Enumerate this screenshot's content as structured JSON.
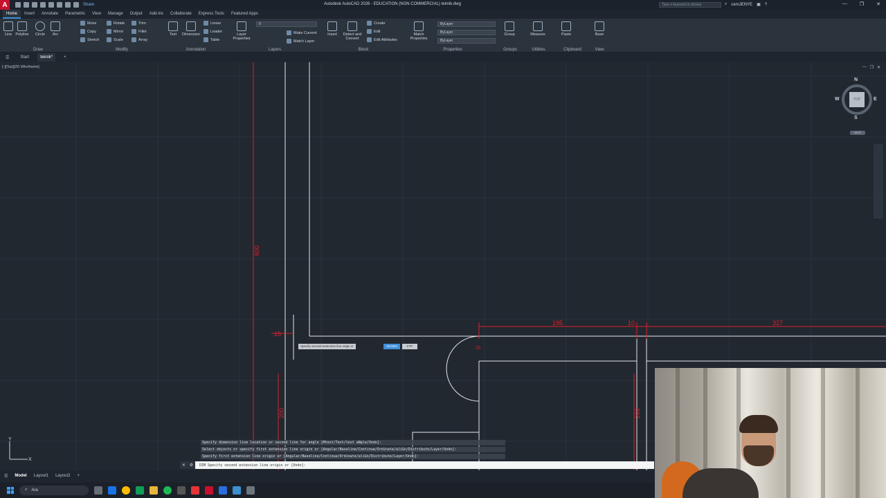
{
  "titlebar": {
    "logo": "A",
    "share": "Share",
    "title": "Autodesk AutoCAD 2026 - EDUCATION (NON COMMERCIAL)    teknik.dwg",
    "search_placeholder": "Type a keyword or phrase",
    "user": "cemJENYE"
  },
  "ribbon_tabs": [
    "Home",
    "Insert",
    "Annotate",
    "Parametric",
    "View",
    "Manage",
    "Output",
    "Add-ins",
    "Collaborate",
    "Express Tools",
    "Featured Apps"
  ],
  "ribbon": {
    "draw": {
      "label": "Draw",
      "tools": [
        "Line",
        "Polyline",
        "Circle",
        "Arc"
      ]
    },
    "modify": {
      "label": "Modify",
      "tools": [
        "Move",
        "Rotate",
        "Trim",
        "Copy",
        "Mirror",
        "Fillet",
        "Stretch",
        "Scale",
        "Array"
      ]
    },
    "annotation": {
      "label": "Annotation",
      "tools": [
        "Text",
        "Dimension",
        "Linear",
        "Leader",
        "Table"
      ]
    },
    "layers": {
      "label": "Layers",
      "tools": [
        "Layer Properties",
        "Make Current",
        "Match Layer"
      ],
      "current_layer": "0"
    },
    "block": {
      "label": "Block",
      "tools": [
        "Insert",
        "Detect and Convert",
        "Create",
        "Edit",
        "Edit Attributes"
      ]
    },
    "properties": {
      "label": "Properties",
      "tools": [
        "Match Properties"
      ],
      "color": "ByLayer",
      "linetype": "ByLayer",
      "lineweight": "ByLayer"
    },
    "groups": {
      "label": "Groups",
      "tools": [
        "Group"
      ]
    },
    "utilities": {
      "label": "Utilities",
      "tools": [
        "Measure"
      ]
    },
    "clipboard": {
      "label": "Clipboard",
      "tools": [
        "Paste"
      ]
    },
    "view": {
      "label": "View",
      "tools": [
        "Base"
      ]
    }
  },
  "file_tabs": [
    "Start",
    "teknik*"
  ],
  "viewport": {
    "label": "[-][Top][2D Wireframe]",
    "viewcube": {
      "n": "N",
      "s": "S",
      "e": "E",
      "w": "W",
      "face": "TOP",
      "wcs": "WCS"
    }
  },
  "dimensions": {
    "vertical_left": "600",
    "d195": "195",
    "d10": "10",
    "d327": "327",
    "d200a": "200",
    "d200b": "200",
    "d15": "15",
    "d0": "0"
  },
  "dynamic_input": {
    "prompt": "Specify second extension line origin or",
    "value": "18.0324",
    "angle": "179°"
  },
  "command": {
    "history": [
      "Specify dimension line location or second line for angle [Mtext/Text/text aNgle/Undo]:",
      "Select objects or specify first extension line origin or [Angular/Baseline/Continue/Ordinate/aliGn/Distribute/Layer/Undo]:",
      "Specify first extension line origin or [Angular/Baseline/Continue/Ordinate/aliGn/Distribute/Layer/Undo]:"
    ],
    "current": "DIM Specify second extension line origin or [Undo]:"
  },
  "layout_tabs": [
    "Model",
    "Layout1",
    "Layout2"
  ],
  "taskbar": {
    "search": "Ara"
  },
  "colors": {
    "dimension": "#e0202a",
    "geometry": "#e6e9ed",
    "background": "#212830",
    "accent": "#3f8fd8"
  }
}
